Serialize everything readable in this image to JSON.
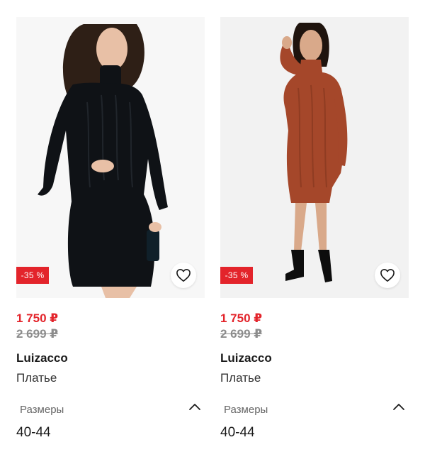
{
  "products": [
    {
      "discount_badge": "-35 %",
      "price_current": "1 750 ₽",
      "price_old": "2 699 ₽",
      "brand": "Luizacco",
      "type": "Платье",
      "sizes_label": "Размеры",
      "sizes_value": "40-44",
      "dress_color": "#0f1216",
      "icons": [
        "heart-icon",
        "chevron-up-icon"
      ]
    },
    {
      "discount_badge": "-35 %",
      "price_current": "1 750 ₽",
      "price_old": "2 699 ₽",
      "brand": "Luizacco",
      "type": "Платье",
      "sizes_label": "Размеры",
      "sizes_value": "40-44",
      "dress_color": "#a5472a",
      "icons": [
        "heart-icon",
        "chevron-up-icon"
      ]
    }
  ],
  "colors": {
    "accent_red": "#e3242b",
    "old_price_gray": "#8c8c8c"
  }
}
